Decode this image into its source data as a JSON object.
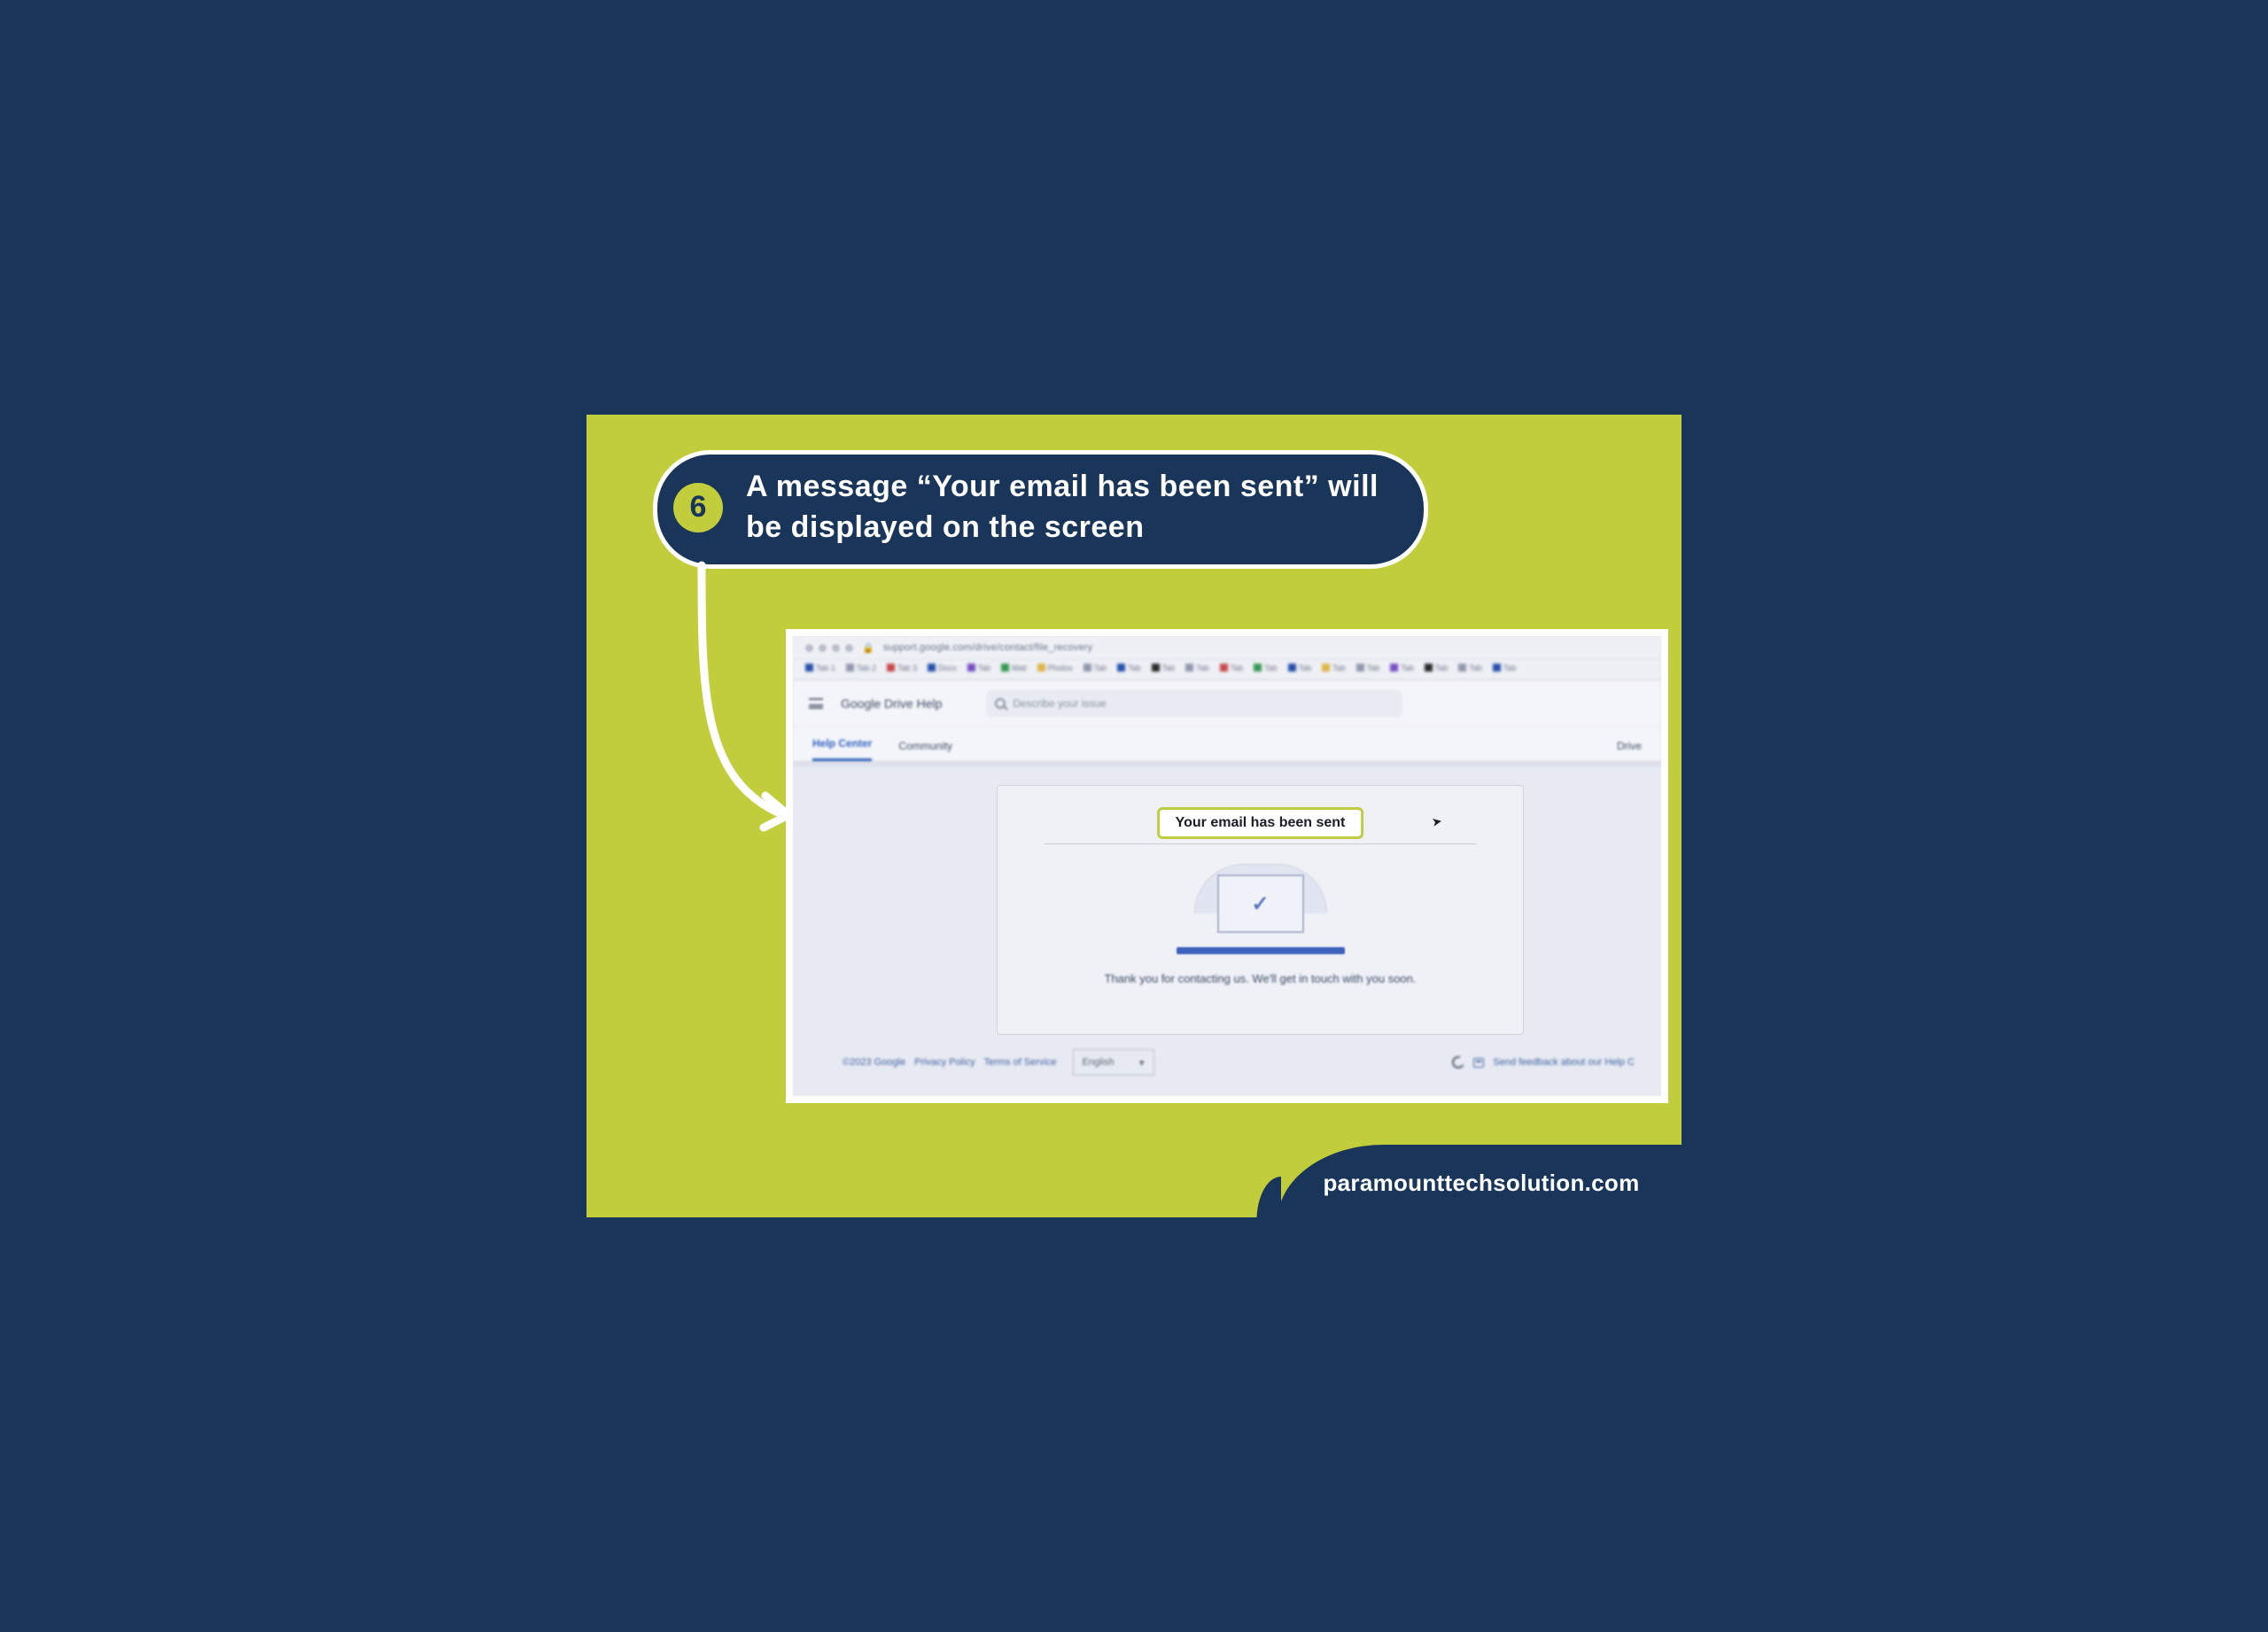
{
  "step": {
    "number": "6",
    "text": "A message “Your email has been sent” will be displayed on the screen"
  },
  "browser": {
    "url": "support.google.com/drive/contact/file_recovery",
    "bookmarks": [
      "Tab 1",
      "Tab 2",
      "Tab 3",
      "Docs",
      "Tab",
      "Mail",
      "Photos",
      "Tab",
      "Tab",
      "Tab",
      "Tab",
      "Tab",
      "Tab",
      "Tab",
      "Tab",
      "Tab",
      "Tab",
      "Tab",
      "Tab",
      "Tab"
    ]
  },
  "app": {
    "title": "Google Drive Help",
    "search_placeholder": "Describe your issue",
    "tabs": {
      "helpCenter": "Help Center",
      "community": "Community",
      "right": "Drive"
    }
  },
  "card": {
    "heading": "Your email has been sent",
    "thanks": "Thank you for contacting us. We'll get in touch with you soon."
  },
  "footer": {
    "links": [
      "©2023 Google",
      "Privacy Policy",
      "Terms of Service"
    ],
    "language": "English",
    "feedback": "Send feedback about our Help C"
  },
  "brand": "paramounttechsolution.com"
}
